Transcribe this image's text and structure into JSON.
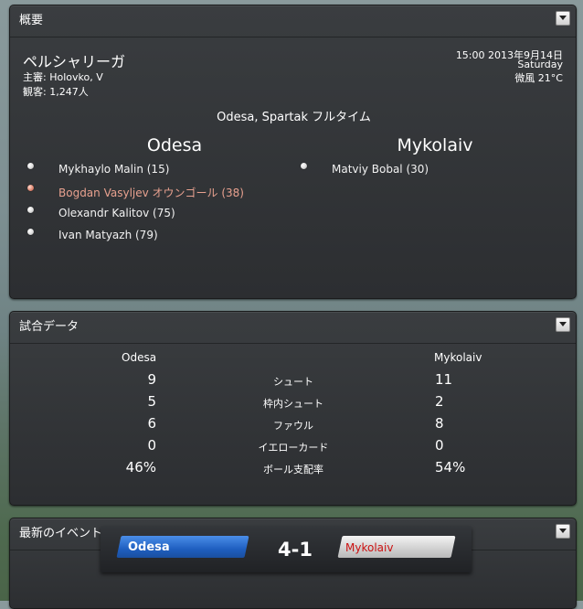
{
  "summary": {
    "header": "概要",
    "competition": "ペルシャリーガ",
    "referee_label": "主審",
    "referee": "Holovko, V",
    "attendance_label": "観客",
    "attendance": "1,247人",
    "datetime": "15:00 2013年9月14日",
    "weekday": "Saturday",
    "weather": "微風 21°C",
    "result_line": "Odesa, Spartak フルタイム",
    "home_team": "Odesa",
    "away_team": "Mykolaiv",
    "home_scorers": [
      {
        "text": "Mykhaylo Malin (15)",
        "own_goal": false
      },
      {
        "text": "Bogdan Vasyljev オウンゴール (38)",
        "own_goal": true
      },
      {
        "text": "Olexandr Kalitov (75)",
        "own_goal": false
      },
      {
        "text": "Ivan Matyazh (79)",
        "own_goal": false
      }
    ],
    "away_scorers": [
      {
        "text": "Matviy Bobal (30)",
        "own_goal": false
      }
    ]
  },
  "match_stats": {
    "header": "試合データ",
    "home_team": "Odesa",
    "away_team": "Mykolaiv",
    "rows": [
      {
        "label": "シュート",
        "home": "9",
        "away": "11"
      },
      {
        "label": "枠内シュート",
        "home": "5",
        "away": "2"
      },
      {
        "label": "ファウル",
        "home": "6",
        "away": "8"
      },
      {
        "label": "イエローカード",
        "home": "0",
        "away": "0"
      },
      {
        "label": "ボール支配率",
        "home": "46%",
        "away": "54%"
      }
    ]
  },
  "latest_events": {
    "header": "最新のイベント"
  },
  "scorebar": {
    "home": "Odesa",
    "score": "4-1",
    "away": "Mykolaiv",
    "home_color": "#1f5fc0",
    "away_text_color": "#cc1111"
  }
}
